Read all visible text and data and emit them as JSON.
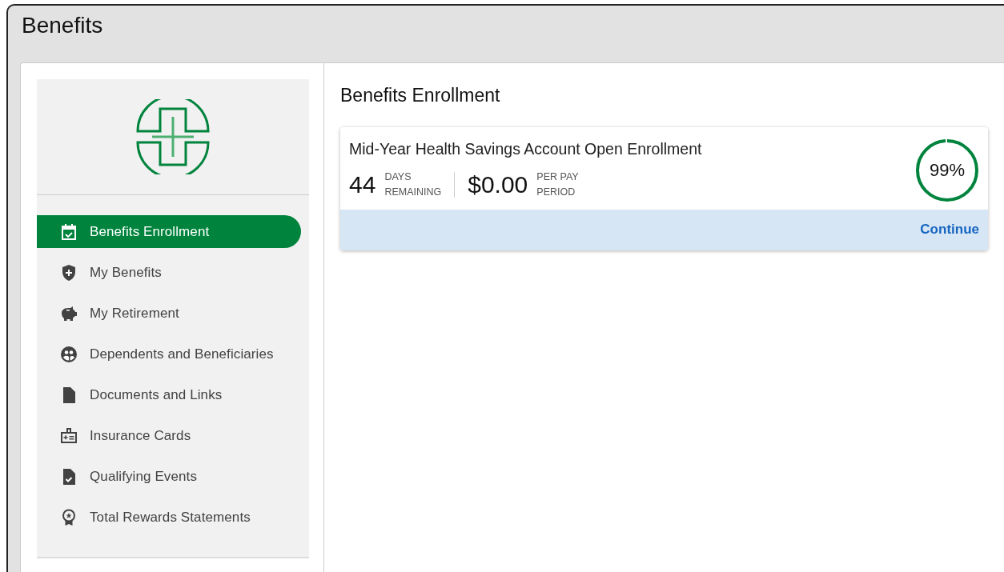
{
  "page": {
    "title": "Benefits"
  },
  "nav": [
    {
      "kind": "calendar",
      "label": "Benefits Enrollment",
      "selected": true
    },
    {
      "kind": "shield",
      "label": "My Benefits",
      "selected": false
    },
    {
      "kind": "piggy",
      "label": "My Retirement",
      "selected": false
    },
    {
      "kind": "people",
      "label": "Dependents and Beneficiaries",
      "selected": false
    },
    {
      "kind": "document",
      "label": "Documents and Links",
      "selected": false
    },
    {
      "kind": "card",
      "label": "Insurance Cards",
      "selected": false
    },
    {
      "kind": "checkdoc",
      "label": "Qualifying Events",
      "selected": false
    },
    {
      "kind": "award",
      "label": "Total Rewards Statements",
      "selected": false
    }
  ],
  "main": {
    "heading": "Benefits Enrollment",
    "enrollment": {
      "title": "Mid-Year Health Savings Account Open Enrollment",
      "days": "44",
      "days_label_1": "DAYS",
      "days_label_2": "REMAINING",
      "amount": "$0.00",
      "amount_label_1": "PER PAY",
      "amount_label_2": "PERIOD",
      "progress": {
        "level": 0.99,
        "reading": "99%"
      },
      "action": "Continue"
    }
  }
}
